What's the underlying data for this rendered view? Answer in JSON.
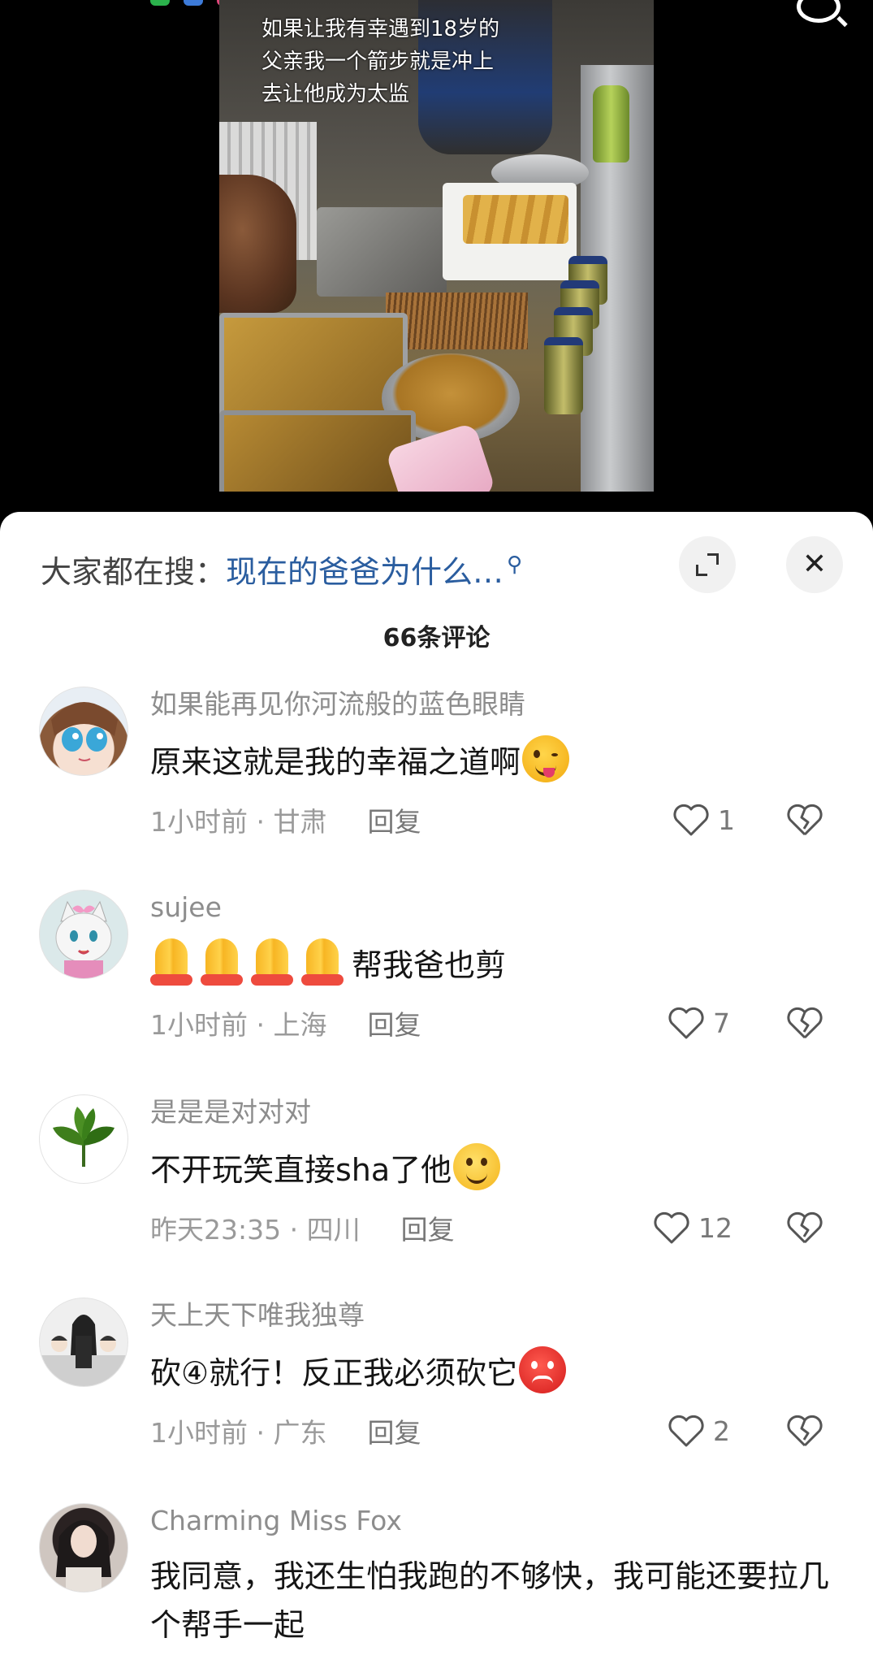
{
  "video": {
    "caption": "如果让我有幸遇到18岁的父亲我一个箭步就是冲上去让他成为太监"
  },
  "comments_panel": {
    "hot_search_label": "大家都在搜：",
    "hot_search_query": "现在的爸爸为什么…",
    "comment_count": "66条评论",
    "comments": [
      {
        "username": "如果能再见你河流般的蓝色眼睛",
        "text": "原来这就是我的幸福之道啊",
        "emoji": "winking-tongue-emoji",
        "time": "1小时前",
        "location": "甘肃",
        "reply_label": "回复",
        "likes": "1",
        "avatar": "anime-girl-avatar"
      },
      {
        "username": "sujee",
        "text": "帮我爸也剪",
        "emoji": "folded-hands-emoji x4",
        "time": "1小时前",
        "location": "上海",
        "reply_label": "回复",
        "likes": "7",
        "avatar": "cartoon-cat-avatar"
      },
      {
        "username": "是是是对对对",
        "text": "不开玩笑直接sha了他",
        "emoji": "smile-emoji",
        "time": "昨天23:35",
        "location": "四川",
        "reply_label": "回复",
        "likes": "12",
        "avatar": "green-leaf-avatar"
      },
      {
        "username": "天上天下唯我独尊",
        "text": "砍④就行！反正我必须砍它",
        "emoji": "angry-emoji",
        "time": "1小时前",
        "location": "广东",
        "reply_label": "回复",
        "likes": "2",
        "avatar": "anime-group-avatar"
      },
      {
        "username": "Charming Miss Fox",
        "text": "我同意，我还生怕我跑的不够快，我可能还要拉几个帮手一起",
        "avatar": "photo-avatar"
      }
    ]
  },
  "colors": {
    "link_blue": "#2a5d9f",
    "meta_gray": "#9a9a9a",
    "panel_bg": "#ffffff"
  }
}
